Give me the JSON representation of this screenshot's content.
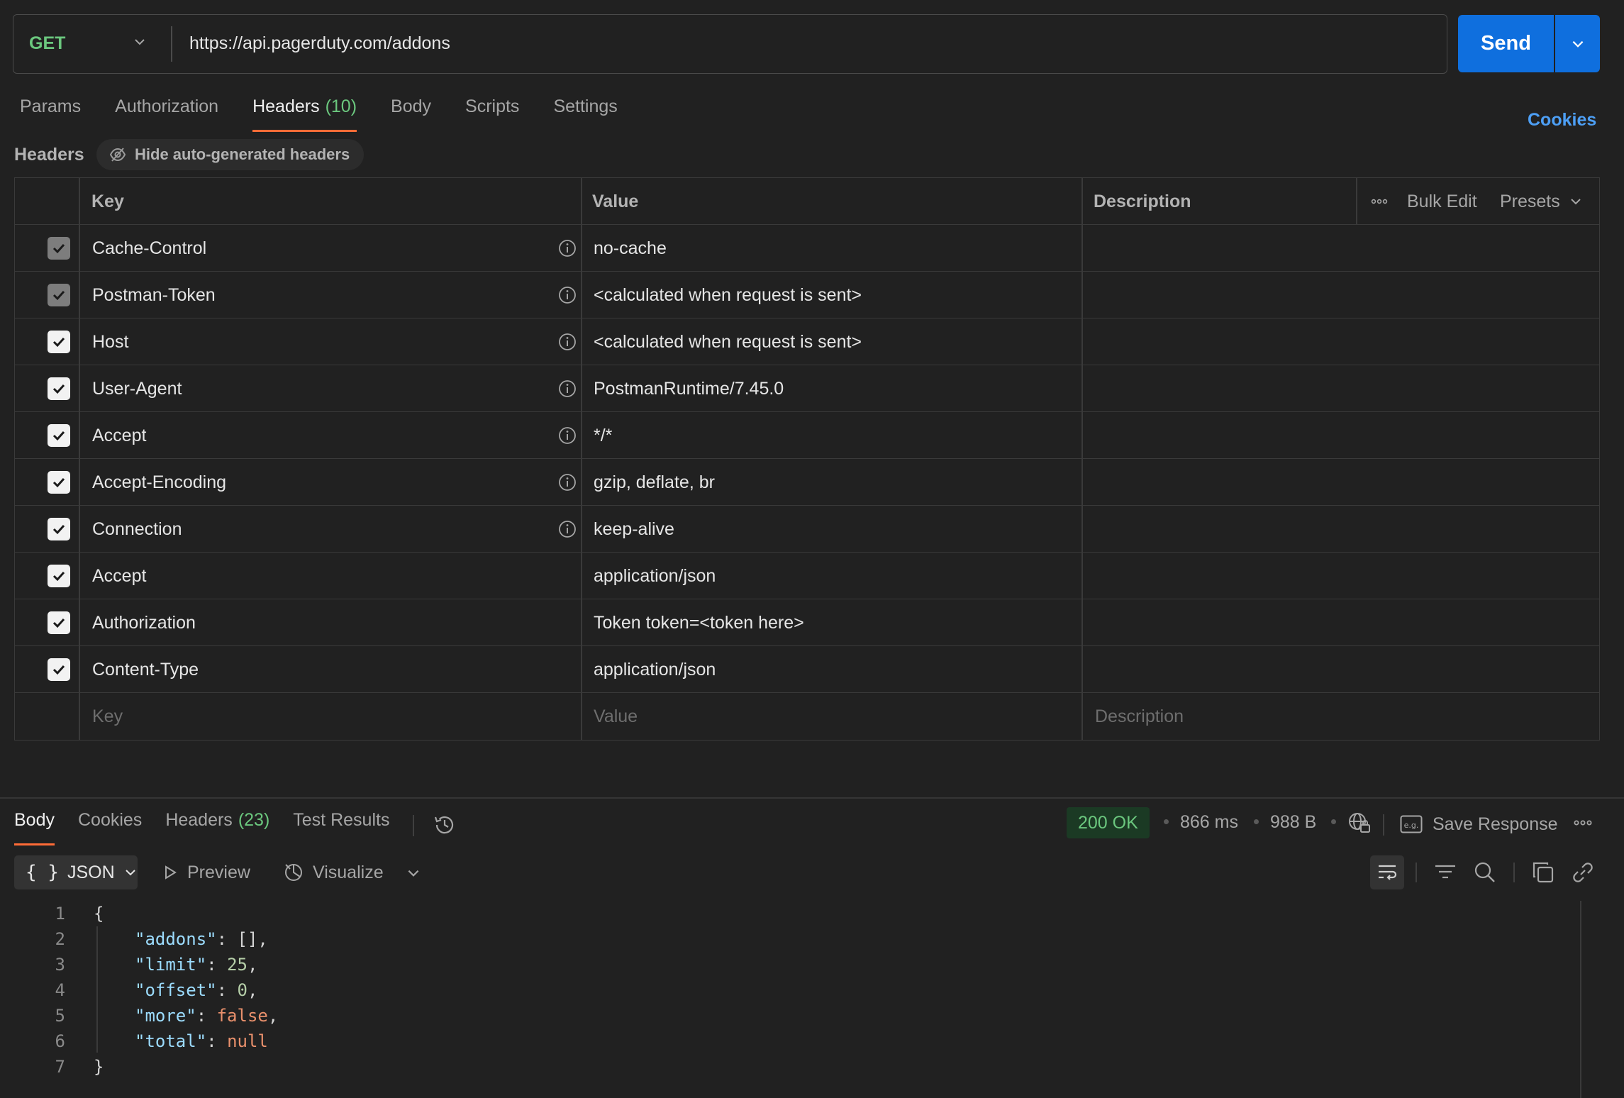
{
  "request": {
    "method": "GET",
    "url": "https://api.pagerduty.com/addons",
    "send_label": "Send"
  },
  "tabs": [
    {
      "label": "Params"
    },
    {
      "label": "Authorization"
    },
    {
      "label": "Headers",
      "count": "(10)"
    },
    {
      "label": "Body"
    },
    {
      "label": "Scripts"
    },
    {
      "label": "Settings"
    }
  ],
  "cookies_link": "Cookies",
  "headers_section": {
    "title": "Headers",
    "hide_auto_label": "Hide auto-generated headers"
  },
  "table": {
    "columns": {
      "key": "Key",
      "value": "Value",
      "description": "Description"
    },
    "bulk_edit": "Bulk Edit",
    "presets": "Presets",
    "rows": [
      {
        "key": "Cache-Control",
        "value": "no-cache",
        "checked": "disabled",
        "info": true
      },
      {
        "key": "Postman-Token",
        "value": "<calculated when request is sent>",
        "checked": "disabled",
        "info": true
      },
      {
        "key": "Host",
        "value": "<calculated when request is sent>",
        "checked": "on",
        "info": true
      },
      {
        "key": "User-Agent",
        "value": "PostmanRuntime/7.45.0",
        "checked": "on",
        "info": true
      },
      {
        "key": "Accept",
        "value": "*/*",
        "checked": "on",
        "info": true
      },
      {
        "key": "Accept-Encoding",
        "value": "gzip, deflate, br",
        "checked": "on",
        "info": true
      },
      {
        "key": "Connection",
        "value": "keep-alive",
        "checked": "on",
        "info": true
      },
      {
        "key": "Accept",
        "value": "application/json",
        "checked": "on",
        "info": false
      },
      {
        "key": "Authorization",
        "value": "Token token=<token here>",
        "checked": "on",
        "info": false
      },
      {
        "key": "Content-Type",
        "value": "application/json",
        "checked": "on",
        "info": false
      }
    ],
    "placeholder": {
      "key": "Key",
      "value": "Value",
      "description": "Description"
    }
  },
  "response": {
    "tabs": [
      {
        "label": "Body"
      },
      {
        "label": "Cookies"
      },
      {
        "label": "Headers",
        "count": "(23)"
      },
      {
        "label": "Test Results"
      }
    ],
    "status": "200 OK",
    "time": "866 ms",
    "size": "988 B",
    "save_response": "Save Response",
    "format": "JSON",
    "preview": "Preview",
    "visualize": "Visualize",
    "lines": [
      "1",
      "2",
      "3",
      "4",
      "5",
      "6",
      "7"
    ],
    "json": {
      "open": "{",
      "close": "}",
      "addons_key": "\"addons\"",
      "addons_val": "[]",
      "limit_key": "\"limit\"",
      "limit_val": "25",
      "offset_key": "\"offset\"",
      "offset_val": "0",
      "more_key": "\"more\"",
      "more_val": "false",
      "total_key": "\"total\"",
      "total_val": "null"
    }
  },
  "colors": {
    "background": "#212121",
    "accent_orange": "#ff6c37",
    "send_blue": "#0f6fde",
    "method_green": "#6bc77e",
    "link_blue": "#4d9ff5"
  }
}
